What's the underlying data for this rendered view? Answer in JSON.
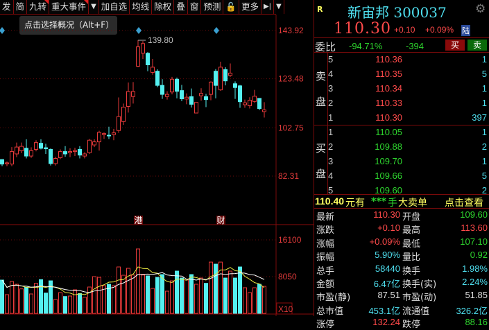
{
  "toolbar": {
    "items": [
      "发",
      "简",
      "九转",
      "重大事件",
      "▼",
      "加自选",
      "均线",
      "除权",
      "叠",
      "窗",
      "预测",
      "🔓",
      "更多",
      "▶|",
      "▼"
    ],
    "flagged": [
      2,
      3
    ]
  },
  "tooltip": "点击选择概况（Alt+F）",
  "chart_data": {
    "type": "candlestick",
    "price_axis": {
      "ticks": [
        "143.92",
        "123.48",
        "102.75",
        "82.31"
      ],
      "values": [
        143.92,
        123.48,
        102.75,
        82.31
      ]
    },
    "high_label": "139.80",
    "volume_axis": {
      "ticks": [
        "16100",
        "8050"
      ],
      "values": [
        16100,
        8050
      ],
      "unit_label": "X10"
    },
    "event_markers": [
      {
        "index": 28,
        "label": "港"
      },
      {
        "index": 45,
        "label": "财"
      }
    ],
    "diamond_indices": [
      0,
      28,
      44
    ],
    "candles": [
      [
        89.3,
        87.4,
        89.5,
        86.5
      ],
      [
        87.5,
        87.9,
        88.5,
        86.5
      ],
      [
        87.4,
        92.7,
        94.6,
        86.5
      ],
      [
        91.7,
        94.6,
        96.5,
        90.3
      ],
      [
        93,
        94.9,
        96.5,
        92
      ],
      [
        94.1,
        90.8,
        97.9,
        89.8
      ],
      [
        90.8,
        93.1,
        94.5,
        90
      ],
      [
        93.6,
        96.5,
        97.5,
        92.8
      ],
      [
        96.2,
        94.1,
        97.9,
        93.6
      ],
      [
        94.3,
        93.9,
        96,
        91.7
      ],
      [
        93.6,
        87.6,
        94,
        86.8
      ],
      [
        87.6,
        89.8,
        90.5,
        86.8
      ],
      [
        90.1,
        92.7,
        93.6,
        89.5
      ],
      [
        92.7,
        91.7,
        95,
        90.5
      ],
      [
        92.2,
        92.7,
        94.1,
        90.3
      ],
      [
        92.7,
        93.1,
        94.3,
        90.8
      ],
      [
        93.6,
        91.2,
        95,
        89.8
      ],
      [
        90.8,
        91.7,
        92.4,
        89.8
      ],
      [
        92.2,
        97.5,
        98,
        91.7
      ],
      [
        95.5,
        96.8,
        97.9,
        94.6
      ],
      [
        96.8,
        100.8,
        101.5,
        93.1
      ],
      [
        99.9,
        100.3,
        100.8,
        98
      ],
      [
        99.6,
        99.4,
        103.2,
        98
      ],
      [
        99.9,
        100.6,
        102.3,
        97.5
      ],
      [
        101.6,
        107.5,
        115.6,
        100.6
      ],
      [
        105.4,
        111.5,
        113,
        104
      ],
      [
        111.8,
        118.1,
        121.9,
        109.2
      ],
      [
        116,
        118.1,
        122.1,
        113
      ],
      [
        128.8,
        137,
        139.8,
        128.4
      ],
      [
        134.3,
        138.4,
        139.5,
        131.9
      ],
      [
        134.3,
        129.4,
        134.8,
        126.7
      ],
      [
        126.2,
        128.4,
        131.9,
        125.2
      ],
      [
        126.7,
        120.7,
        127.5,
        119.9
      ],
      [
        120.7,
        116.9,
        123.3,
        115
      ],
      [
        116,
        116.9,
        118.2,
        114.7
      ],
      [
        117.9,
        123.3,
        124.3,
        116.9
      ],
      [
        123.3,
        118.2,
        124,
        115.2
      ],
      [
        118.5,
        115,
        120.9,
        114
      ],
      [
        114.9,
        115.7,
        117.3,
        112.7
      ],
      [
        115.9,
        112.7,
        119.4,
        111.3
      ],
      [
        109,
        113.5,
        113.5,
        108.9
      ],
      [
        116.3,
        117.3,
        119.5,
        114.2
      ],
      [
        115.9,
        114.7,
        117.1,
        111.5
      ],
      [
        116.9,
        122.1,
        122.4,
        114.4
      ],
      [
        126.7,
        120.7,
        127.6,
        115.2
      ],
      [
        118.8,
        128.4,
        130.7,
        118.4
      ],
      [
        127.4,
        122.6,
        128.4,
        120.7
      ],
      [
        124.9,
        125.9,
        130,
        124.3
      ],
      [
        121.4,
        119.8,
        122.4,
        115
      ],
      [
        120.5,
        113.8,
        120.9,
        111.2
      ],
      [
        112.5,
        113.3,
        114.7,
        111.2
      ],
      [
        112.1,
        114.4,
        115.7,
        110.9
      ],
      [
        113.9,
        116.1,
        118.8,
        113.3
      ],
      [
        115.2,
        110.9,
        115.2,
        110.2
      ],
      [
        109.6,
        110.3,
        113.6,
        107.1
      ]
    ],
    "volumes": [
      7290,
      4100,
      6980,
      6380,
      5360,
      5720,
      4250,
      6580,
      7390,
      4450,
      7130,
      3040,
      4550,
      3690,
      3800,
      5160,
      4350,
      3540,
      5770,
      8050,
      7890,
      6070,
      6380,
      6070,
      10170,
      8350,
      9870,
      8400,
      14120,
      8400,
      8200,
      5460,
      7890,
      8500,
      4860,
      7130,
      9260,
      7740,
      7290,
      8500,
      6380,
      7740,
      6580,
      11230,
      10780,
      11230,
      7740,
      9260,
      7740,
      10170,
      5620,
      4550,
      5620,
      6380,
      5920
    ],
    "colors": {
      "up": "#e83a3a",
      "down": "#54f0f0",
      "grid": "#6a0a0a",
      "ma_short": "#ffffff",
      "ma_long": "#e8e840"
    }
  },
  "quote": {
    "badge": "R",
    "name_code": "新宙邦 300037",
    "price": "110.30",
    "change": "+0.10",
    "change_pct": "+0.09%",
    "market_tag": "陆",
    "ratio_label": "委比",
    "ratio": "-94.71%",
    "diff": "-394",
    "buy_btn": "买",
    "sell_btn": "卖"
  },
  "sell_label": [
    "卖",
    "盘"
  ],
  "buy_label": [
    "买",
    "盘"
  ],
  "asks": [
    {
      "level": "5",
      "price": "110.36",
      "vol": "1"
    },
    {
      "level": "4",
      "price": "110.35",
      "vol": "5"
    },
    {
      "level": "3",
      "price": "110.34",
      "vol": "1"
    },
    {
      "level": "2",
      "price": "110.33",
      "vol": "1"
    },
    {
      "level": "1",
      "price": "110.30",
      "vol": "397"
    }
  ],
  "bids": [
    {
      "level": "1",
      "price": "110.05",
      "vol": "1"
    },
    {
      "level": "2",
      "price": "109.88",
      "vol": "2"
    },
    {
      "level": "3",
      "price": "109.70",
      "vol": "1"
    },
    {
      "level": "4",
      "price": "109.66",
      "vol": "5"
    },
    {
      "level": "5",
      "price": "109.60",
      "vol": "2"
    }
  ],
  "big_order": {
    "price": "110.40",
    "text1": "元有",
    "stars": "***",
    "text2": "手",
    "text3": "大卖单",
    "link": "点击查看"
  },
  "stats": [
    {
      "l1": "最新",
      "v1": "110.30",
      "c1": "red",
      "l2": "开盘",
      "v2": "109.60",
      "c2": "grn"
    },
    {
      "l1": "涨跌",
      "v1": "+0.10",
      "c1": "red",
      "l2": "最高",
      "v2": "113.60",
      "c2": "red"
    },
    {
      "l1": "涨幅",
      "v1": "+0.09%",
      "c1": "red",
      "l2": "最低",
      "v2": "107.10",
      "c2": "grn"
    },
    {
      "l1": "振幅",
      "v1": "5.90%",
      "c1": "cyan",
      "l2": "量比",
      "v2": "0.92",
      "c2": "grn"
    },
    {
      "l1": "总手",
      "v1": "58440",
      "c1": "cyan",
      "l2": "换手",
      "v2": "1.98%",
      "c2": "cyan"
    },
    {
      "l1": "金额",
      "v1": "6.47亿",
      "c1": "cyan",
      "l2": "换手(实)",
      "v2": "2.24%",
      "c2": "cyan"
    },
    {
      "l1": "市盈(静)",
      "v1": "87.51",
      "c1": "wht",
      "l2": "市盈(动)",
      "v2": "51.85",
      "c2": "wht"
    },
    {
      "l1": "总市值",
      "v1": "453.1亿",
      "c1": "cyan",
      "l2": "流通值",
      "v2": "326.2亿",
      "c2": "cyan"
    },
    {
      "l1": "涨停",
      "v1": "132.24",
      "c1": "red",
      "l2": "跌停",
      "v2": "88.16",
      "c2": "grn"
    }
  ]
}
